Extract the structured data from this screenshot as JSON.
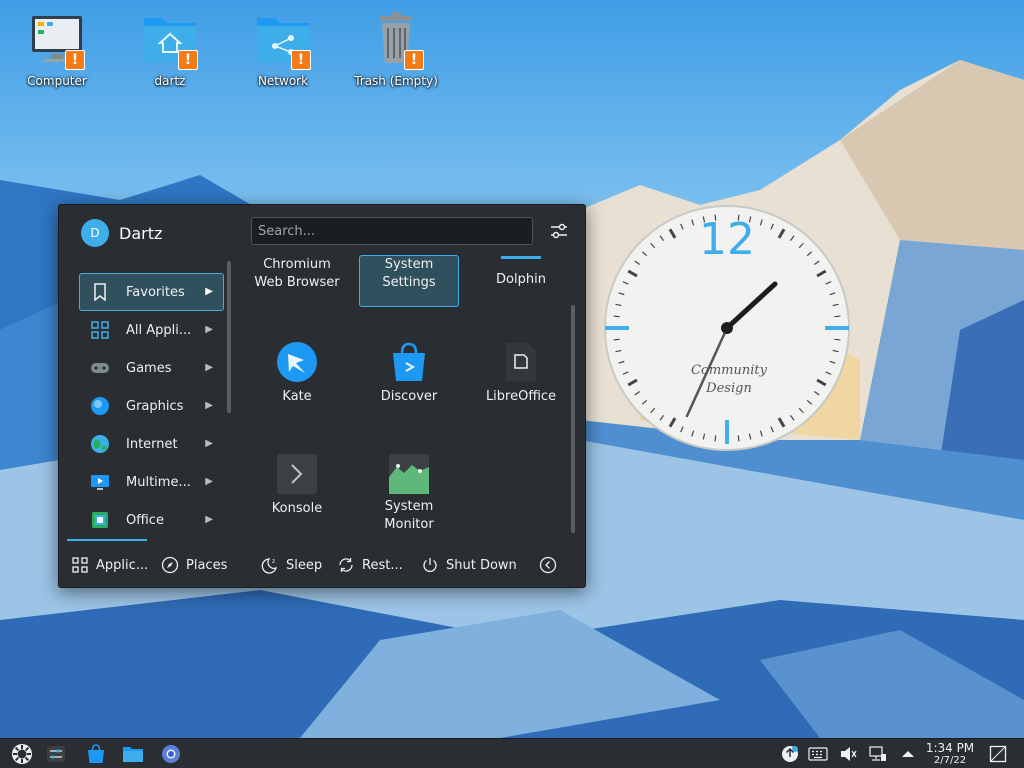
{
  "desktop": {
    "icons": [
      {
        "label": "Computer"
      },
      {
        "label": "dartz"
      },
      {
        "label": "Network"
      },
      {
        "label": "Trash (Empty)"
      }
    ],
    "warning_glyph": "!"
  },
  "launcher": {
    "user": {
      "initial": "D",
      "name": "Dartz"
    },
    "search_placeholder": "Search...",
    "categories": [
      {
        "label": "Favorites",
        "icon": "bookmark-icon"
      },
      {
        "label": "All Appli...",
        "icon": "grid-icon"
      },
      {
        "label": "Games",
        "icon": "gamepad-icon"
      },
      {
        "label": "Graphics",
        "icon": "graphics-icon"
      },
      {
        "label": "Internet",
        "icon": "globe-icon"
      },
      {
        "label": "Multime...",
        "icon": "multimedia-icon"
      },
      {
        "label": "Office",
        "icon": "office-icon"
      }
    ],
    "apps": [
      {
        "line1": "Chromium",
        "line2": "Web Browser"
      },
      {
        "line1": "System",
        "line2": "Settings"
      },
      {
        "line1": "Dolphin",
        "line2": ""
      },
      {
        "line1": "Kate",
        "line2": ""
      },
      {
        "line1": "Discover",
        "line2": ""
      },
      {
        "line1": "LibreOffice",
        "line2": ""
      },
      {
        "line1": "Konsole",
        "line2": ""
      },
      {
        "line1": "System",
        "line2": "Monitor"
      }
    ],
    "footer": {
      "applications": "Applic...",
      "places": "Places",
      "sleep": "Sleep",
      "restart": "Rest...",
      "shutdown": "Shut Down"
    }
  },
  "clock_widget": {
    "numeral": "12",
    "brand_line1": "Community",
    "brand_line2": "Design"
  },
  "taskbar": {
    "time": "1:34 PM",
    "date": "2/7/22"
  },
  "colors": {
    "accent": "#3daee9",
    "panel": "#2a2e32",
    "warning": "#f47b16"
  }
}
